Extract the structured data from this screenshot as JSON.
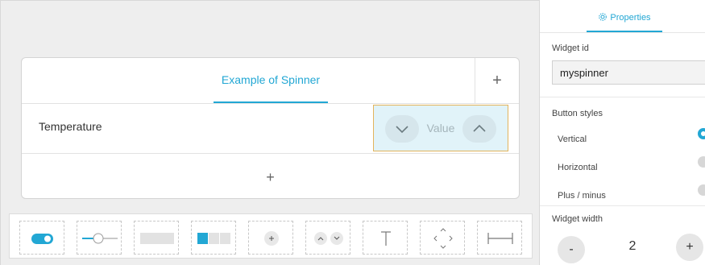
{
  "panel": {
    "title": "Example of Spinner",
    "add_column_icon": "+",
    "row_label": "Temperature",
    "spinner_value": "Value",
    "add_row_icon": "+"
  },
  "toolbar": {
    "tools": [
      "toggle-tool-icon",
      "slider-tool-icon",
      "textbox-tool-icon",
      "groupbutton-tool-icon",
      "button-tool-icon",
      "spinner-tool-icon",
      "text-tool-icon",
      "directional-pad-tool-icon",
      "spacer-tool-icon"
    ]
  },
  "properties": {
    "tab_label": "Properties",
    "tab_icon": "gear-icon",
    "widget_id_label": "Widget id",
    "widget_id_value": "myspinner",
    "button_styles_label": "Button styles",
    "options": [
      "Vertical",
      "Horizontal",
      "Plus / minus"
    ],
    "selected_option": "Vertical",
    "widget_width_label": "Widget width",
    "minus": "-",
    "width_value": "2",
    "plus": "+"
  },
  "colors": {
    "accent": "#22a7d4",
    "spinner_bg": "#e1f3f9",
    "selection_border": "#e3b45c"
  }
}
